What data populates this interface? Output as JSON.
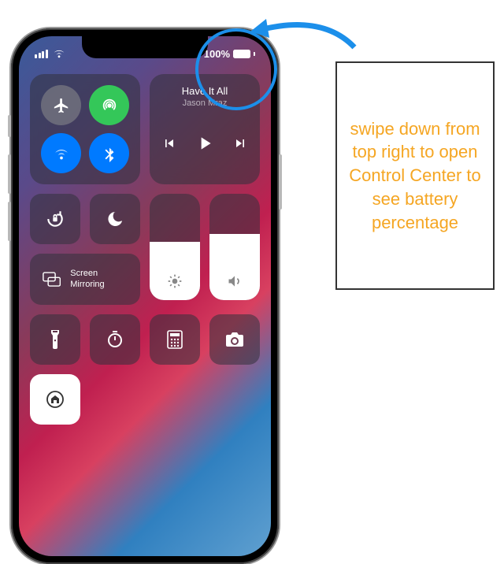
{
  "status": {
    "battery_percent": "100%"
  },
  "music": {
    "title": "Have It All",
    "artist": "Jason Mraz"
  },
  "mirror": {
    "label": "Screen\nMirroring"
  },
  "slider": {
    "brightness_fill": "55%",
    "volume_fill": "62%"
  },
  "callout": {
    "text": "swipe down from top right to open Control Center to see battery percentage"
  }
}
